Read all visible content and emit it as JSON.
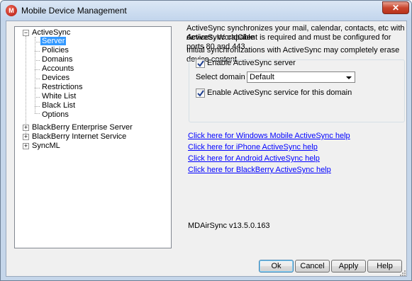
{
  "window": {
    "title": "Mobile Device Management",
    "icon_letter": "M",
    "close_glyph": "✕"
  },
  "tree": {
    "items": [
      {
        "label": "ActiveSync",
        "expander": "−"
      },
      {
        "label": "Server",
        "selected": true
      },
      {
        "label": "Policies"
      },
      {
        "label": "Domains"
      },
      {
        "label": "Accounts"
      },
      {
        "label": "Devices"
      },
      {
        "label": "Restrictions"
      },
      {
        "label": "White List"
      },
      {
        "label": "Black List"
      },
      {
        "label": "Options"
      },
      {
        "label": "BlackBerry Enterprise Server",
        "expander": "+"
      },
      {
        "label": "BlackBerry Internet Service",
        "expander": "+"
      },
      {
        "label": "SyncML",
        "expander": "+"
      }
    ]
  },
  "panel": {
    "intro_line1": "ActiveSync synchronizes your mail, calendar, contacts, etc with ActiveSync capable",
    "intro_line2": "devices.  WorldClient is required and must be configured for ports 80 and 443.",
    "warning": "Initial synchronizations with ActiveSync may completely erase device content.",
    "enable_server_label": "Enable ActiveSync server",
    "enable_server_checked": true,
    "select_domain_label": "Select domain",
    "domain_value": "Default",
    "enable_domain_label": "Enable ActiveSync service for this domain",
    "enable_domain_checked": true,
    "links": [
      "Click here for Windows Mobile ActiveSync help",
      "Click here for iPhone ActiveSync help",
      "Click here for Android ActiveSync help",
      "Click here for BlackBerry ActiveSync help"
    ],
    "version": "MDAirSync v13.5.0.163"
  },
  "buttons": {
    "ok": "Ok",
    "cancel": "Cancel",
    "apply": "Apply",
    "help": "Help"
  },
  "colors": {
    "selection": "#3399ff",
    "link": "#0000ff",
    "close": "#c9462e"
  }
}
